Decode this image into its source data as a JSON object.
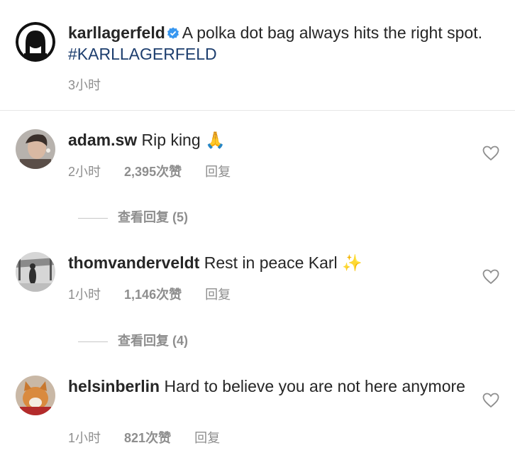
{
  "post": {
    "username": "karllagerfeld",
    "caption": "A polka dot bag always hits the right spot. ",
    "hashtag": "#KARLLAGERFELD",
    "time": "3小时"
  },
  "comments": [
    {
      "username": "adam.sw",
      "text": "Rip king",
      "emoji": "🙏",
      "time": "2小时",
      "likes": "2,395次赞",
      "reply_label": "回复",
      "view_replies": "查看回复 (5)"
    },
    {
      "username": "thomvanderveldt",
      "text": "Rest in peace Karl",
      "emoji": "✨",
      "time": "1小时",
      "likes": "1,146次赞",
      "reply_label": "回复",
      "view_replies": "查看回复 (4)"
    },
    {
      "username": "helsinberlin",
      "text": "Hard to believe you are not here anymore",
      "time": "1小时",
      "likes": "821次赞",
      "reply_label": "回复"
    }
  ],
  "colors": {
    "hashtag": "#1d3e6e",
    "verified": "#3897f0",
    "meta": "#8e8e8e"
  },
  "icons": {
    "verified": "verified-badge-icon",
    "like": "heart-outline-icon"
  }
}
